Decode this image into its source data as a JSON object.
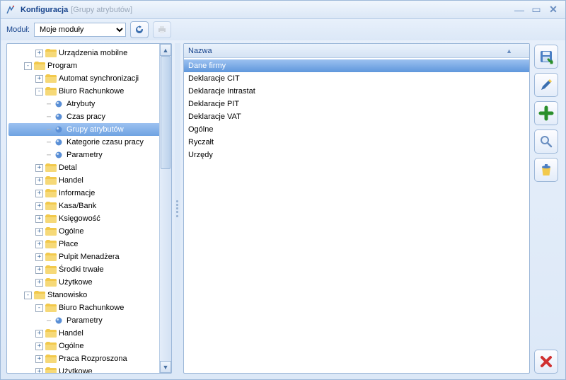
{
  "window": {
    "title": "Konfiguracja",
    "subtitle": "[Grupy atrybutów]"
  },
  "toolbar": {
    "module_label": "Moduł:",
    "module_value": "Moje moduły"
  },
  "tree": [
    {
      "level": 2,
      "expander": "+",
      "type": "folder",
      "label": "Urządzenia mobilne"
    },
    {
      "level": 1,
      "expander": "-",
      "type": "folder",
      "label": "Program"
    },
    {
      "level": 2,
      "expander": "+",
      "type": "folder",
      "label": "Automat synchronizacji"
    },
    {
      "level": 2,
      "expander": "-",
      "type": "folder",
      "label": "Biuro Rachunkowe"
    },
    {
      "level": 3,
      "expander": "",
      "type": "leaf",
      "label": "Atrybuty"
    },
    {
      "level": 3,
      "expander": "",
      "type": "leaf",
      "label": "Czas pracy"
    },
    {
      "level": 3,
      "expander": "",
      "type": "leaf",
      "label": "Grupy atrybutów",
      "selected": true
    },
    {
      "level": 3,
      "expander": "",
      "type": "leaf",
      "label": "Kategorie czasu pracy"
    },
    {
      "level": 3,
      "expander": "",
      "type": "leaf",
      "label": "Parametry"
    },
    {
      "level": 2,
      "expander": "+",
      "type": "folder",
      "label": "Detal"
    },
    {
      "level": 2,
      "expander": "+",
      "type": "folder",
      "label": "Handel"
    },
    {
      "level": 2,
      "expander": "+",
      "type": "folder",
      "label": "Informacje"
    },
    {
      "level": 2,
      "expander": "+",
      "type": "folder",
      "label": "Kasa/Bank"
    },
    {
      "level": 2,
      "expander": "+",
      "type": "folder",
      "label": "Księgowość"
    },
    {
      "level": 2,
      "expander": "+",
      "type": "folder",
      "label": "Ogólne"
    },
    {
      "level": 2,
      "expander": "+",
      "type": "folder",
      "label": "Płace"
    },
    {
      "level": 2,
      "expander": "+",
      "type": "folder",
      "label": "Pulpit Menadżera"
    },
    {
      "level": 2,
      "expander": "+",
      "type": "folder",
      "label": "Środki trwałe"
    },
    {
      "level": 2,
      "expander": "+",
      "type": "folder",
      "label": "Użytkowe"
    },
    {
      "level": 1,
      "expander": "-",
      "type": "folder",
      "label": "Stanowisko"
    },
    {
      "level": 2,
      "expander": "-",
      "type": "folder",
      "label": "Biuro Rachunkowe"
    },
    {
      "level": 3,
      "expander": "",
      "type": "leaf",
      "label": "Parametry"
    },
    {
      "level": 2,
      "expander": "+",
      "type": "folder",
      "label": "Handel"
    },
    {
      "level": 2,
      "expander": "+",
      "type": "folder",
      "label": "Ogólne"
    },
    {
      "level": 2,
      "expander": "+",
      "type": "folder",
      "label": "Praca Rozproszona"
    },
    {
      "level": 2,
      "expander": "+",
      "type": "folder",
      "label": "Użytkowe"
    }
  ],
  "list": {
    "header": "Nazwa",
    "sort_indicator": "▲",
    "items": [
      {
        "label": "Dane firmy",
        "selected": true
      },
      {
        "label": "Deklaracje CIT"
      },
      {
        "label": "Deklaracje Intrastat"
      },
      {
        "label": "Deklaracje PIT"
      },
      {
        "label": "Deklaracje VAT"
      },
      {
        "label": "Ogólne"
      },
      {
        "label": "Ryczałt"
      },
      {
        "label": "Urzędy"
      }
    ]
  },
  "side_icons": {
    "save": "save-icon",
    "edit": "pencil-icon",
    "add": "plus-icon",
    "search": "magnifier-icon",
    "delete": "trash-icon",
    "close": "close-icon"
  }
}
